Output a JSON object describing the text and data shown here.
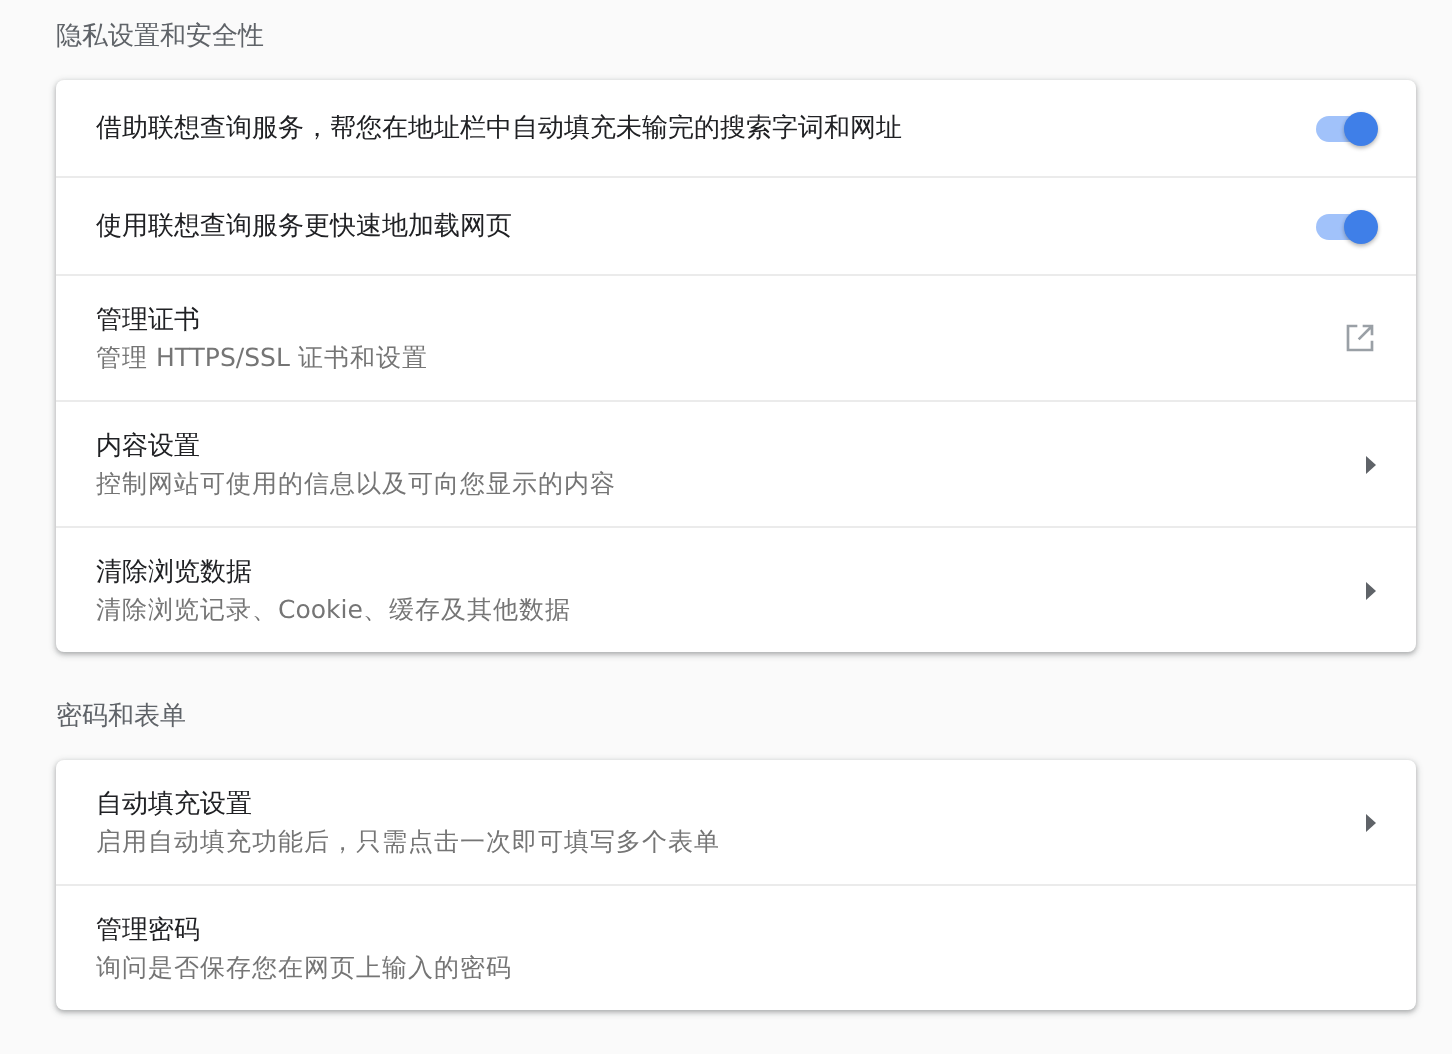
{
  "sections": [
    {
      "title": "隐私设置和安全性",
      "rows": [
        {
          "kind": "toggle",
          "label": "借助联想查询服务，帮您在地址栏中自动填充未输完的搜索字词和网址",
          "on": true
        },
        {
          "kind": "toggle",
          "label": "使用联想查询服务更快速地加载网页",
          "on": true
        },
        {
          "kind": "external",
          "label": "管理证书",
          "sublabel": "管理 HTTPS/SSL 证书和设置"
        },
        {
          "kind": "arrow",
          "label": "内容设置",
          "sublabel": "控制网站可使用的信息以及可向您显示的内容"
        },
        {
          "kind": "arrow",
          "label": "清除浏览数据",
          "sublabel": "清除浏览记录、Cookie、缓存及其他数据"
        }
      ]
    },
    {
      "title": "密码和表单",
      "rows": [
        {
          "kind": "arrow",
          "label": "自动填充设置",
          "sublabel": "启用自动填充功能后，只需点击一次即可填写多个表单"
        },
        {
          "kind": "plain",
          "label": "管理密码",
          "sublabel": "询问是否保存您在网页上输入的密码"
        }
      ]
    }
  ]
}
